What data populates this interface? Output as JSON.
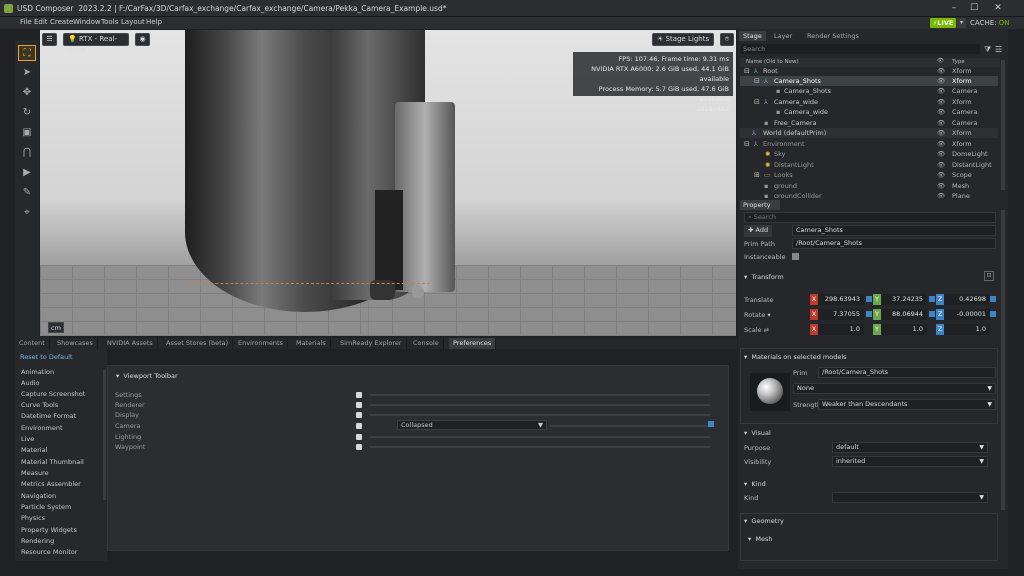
{
  "window": {
    "app_name": "USD Composer",
    "version": "2023.2.2",
    "path": "F:/CarFax/3D/Carfax_exchange/Carfax_exchange/Camera/Pekka_Camera_Example.usd*",
    "minimize": "–",
    "maximize": "☐",
    "close": "✕"
  },
  "menu": [
    "File",
    "Edit",
    "Create",
    "Window",
    "Tools",
    "Layout",
    "Help"
  ],
  "status": {
    "live": "LIVE",
    "cache_label": "CACHE:",
    "cache_value": "ON"
  },
  "viewport": {
    "render_mode": "RTX - Real-Time",
    "stage_lights": "Stage Lights",
    "stats": {
      "fps": "FPS: 107.46, Frame time: 9.31 ms",
      "gpu": "NVIDIA RTX A6000: 2.6 GiB used, 44.1 GiB available",
      "memory": "Process Memory: 5.7 GiB used, 47.6 GiB available",
      "resolution": "2019x883"
    },
    "unit": "cm"
  },
  "bottom_tabs": [
    "Content",
    "Showcases",
    "NVIDIA Assets",
    "Asset Stores (beta)",
    "Environments",
    "Materials",
    "SimReady Explorer",
    "Console",
    "Preferences"
  ],
  "preferences": {
    "reset": "Reset to Default",
    "categories": [
      "Animation",
      "Audio",
      "Capture Screenshot",
      "Curve Tools",
      "Datetime Format",
      "Environment",
      "Live",
      "Material",
      "Material Thumbnail",
      "Measure",
      "Metrics Assembler",
      "Navigation",
      "Particle System",
      "Physics",
      "Property Widgets",
      "Rendering",
      "Resource Monitor"
    ],
    "section": "Viewport Toolbar",
    "rows": [
      "Settings",
      "Renderer",
      "Display",
      "Camera",
      "Lighting",
      "Waypoint"
    ],
    "camera_option": "Collapsed"
  },
  "stage": {
    "tabs": [
      "Stage",
      "Layer",
      "Render Settings"
    ],
    "search_placeholder": "Search",
    "col_name": "Name (Old to New)",
    "col_type": "Type",
    "rows": [
      {
        "name": "Root",
        "type": "Xform"
      },
      {
        "name": "Camera_Shots",
        "type": "Xform"
      },
      {
        "name": "Camera_Shots",
        "type": "Camera"
      },
      {
        "name": "Camera_wide",
        "type": "Xform"
      },
      {
        "name": "Camera_wide",
        "type": "Camera"
      },
      {
        "name": "Free_Camera",
        "type": "Camera"
      },
      {
        "name": "World (defaultPrim)",
        "type": "Xform"
      },
      {
        "name": "Environment",
        "type": "Xform"
      },
      {
        "name": "Sky",
        "type": "DomeLight"
      },
      {
        "name": "DistantLight",
        "type": "DistantLight"
      },
      {
        "name": "Looks",
        "type": "Scope"
      },
      {
        "name": "ground",
        "type": "Mesh"
      },
      {
        "name": "groundCollider",
        "type": "Plane"
      }
    ]
  },
  "property": {
    "tab": "Property",
    "search_placeholder": "Search",
    "add_label": "Add",
    "prim_name": "Camera_Shots",
    "prim_path_label": "Prim Path",
    "prim_path": "/Root/Camera_Shots",
    "instanceable_label": "Instanceable",
    "transform": {
      "title": "Transform",
      "translate_label": "Translate",
      "translate": [
        "298.63943",
        "37.24235",
        "0.42698"
      ],
      "rotate_label": "Rotate ▾",
      "rotate": [
        "7.37055",
        "88.06944",
        "-0.00001"
      ],
      "scale_label": "Scale",
      "scale": [
        "1.0",
        "1.0",
        "1.0"
      ]
    },
    "materials": {
      "title": "Materials on selected models",
      "prim_label": "Prim",
      "prim_value": "/Root/Camera_Shots",
      "material": "None",
      "strength_label": "Strength",
      "strength": "Weaker than Descendants"
    },
    "visual": {
      "title": "Visual",
      "purpose_label": "Purpose",
      "purpose": "default",
      "visibility_label": "Visibility",
      "visibility": "inherited"
    },
    "kind": {
      "title": "Kind",
      "label": "Kind",
      "value": ""
    },
    "geometry": {
      "title": "Geometry",
      "mesh": "Mesh"
    }
  }
}
